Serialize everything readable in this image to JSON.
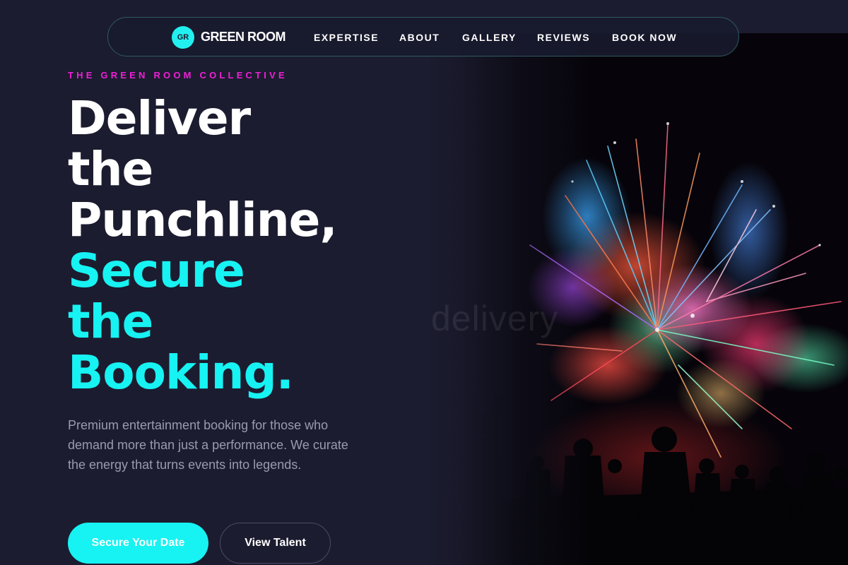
{
  "brand": {
    "badge": "GR",
    "name": "GREEN ROOM"
  },
  "nav": {
    "links": [
      "EXPERTISE",
      "ABOUT",
      "GALLERY",
      "REVIEWS",
      "BOOK NOW"
    ]
  },
  "hero": {
    "eyebrow": "THE GREEN ROOM COLLECTIVE",
    "headline_white": [
      "Deliver",
      "the",
      "Punchline,"
    ],
    "headline_accent": [
      "Secure",
      "the",
      "Booking."
    ],
    "subtext": "Premium entertainment booking for those who demand more than just a performance. We curate the energy that turns events into legends.",
    "primary_cta": "Secure Your Date",
    "secondary_cta": "View Talent",
    "image_watermark": "delivery"
  },
  "colors": {
    "background": "#1c1c30",
    "accent_cyan": "#17f2f2",
    "accent_magenta": "#f01fd7",
    "muted_text": "#9a9ab0"
  }
}
